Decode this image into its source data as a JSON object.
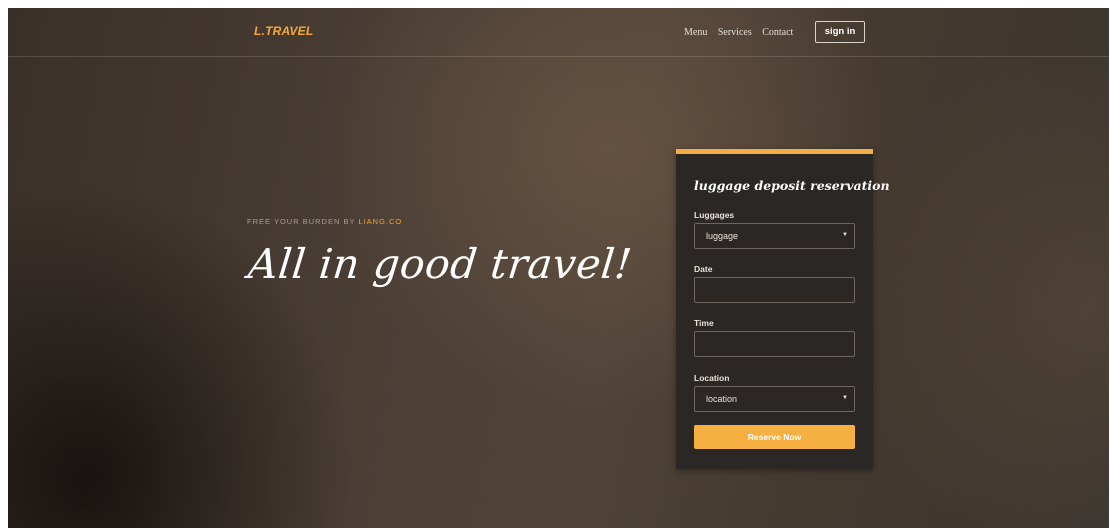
{
  "nav": {
    "brand": "L.TRAVEL",
    "links": [
      "Menu",
      "Services",
      "Contact"
    ],
    "signin": "sign in"
  },
  "hero": {
    "tagline_prefix": "FREE YOUR BURDEN BY",
    "tagline_accent": "LIANG.CO",
    "headline": "All in good travel!"
  },
  "form": {
    "title": "luggage deposit reservation",
    "luggage": {
      "label": "Luggages",
      "value": "luggage"
    },
    "date": {
      "label": "Date",
      "value": ""
    },
    "time": {
      "label": "Time",
      "value": ""
    },
    "location": {
      "label": "Location",
      "value": "location"
    },
    "submit": "Reserve Now"
  },
  "colors": {
    "accent": "#f3ad48",
    "card_bg": "#2b2724",
    "background": "#44392f"
  }
}
